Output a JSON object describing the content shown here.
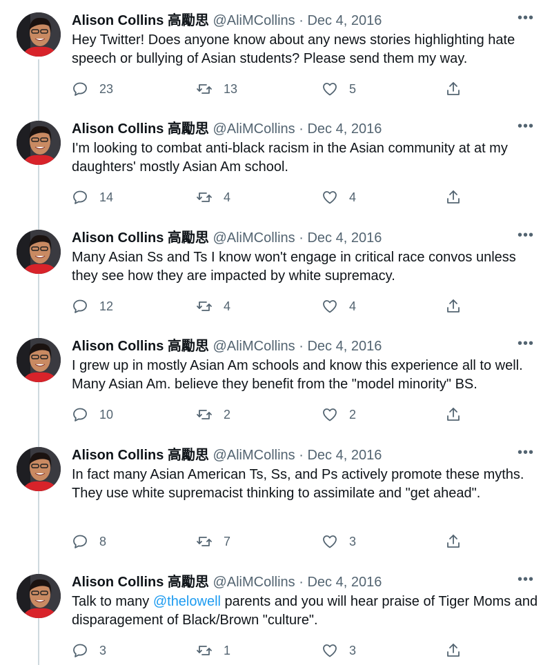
{
  "tweets": [
    {
      "name": "Alison Collins 高勵思",
      "handle": "@AliMCollins",
      "date": "Dec 4, 2016",
      "text": "Hey Twitter! Does anyone know about any news stories highlighting hate speech or bullying of Asian students? Please send them my way.",
      "replies": "23",
      "retweets": "13",
      "likes": "5"
    },
    {
      "name": "Alison Collins 高勵思",
      "handle": "@AliMCollins",
      "date": "Dec 4, 2016",
      "text": "I'm looking to combat anti-black racism in the Asian community at at my daughters' mostly Asian Am school.",
      "replies": "14",
      "retweets": "4",
      "likes": "4"
    },
    {
      "name": "Alison Collins 高勵思",
      "handle": "@AliMCollins",
      "date": "Dec 4, 2016",
      "text": "Many Asian Ss and Ts I know won't engage in critical race convos unless they see how they are impacted by white supremacy.",
      "replies": "12",
      "retweets": "4",
      "likes": "4"
    },
    {
      "name": "Alison Collins 高勵思",
      "handle": "@AliMCollins",
      "date": "Dec 4, 2016",
      "text": "I grew up in mostly Asian Am schools and know this experience all to well. Many Asian Am. believe they benefit from the \"model minority\" BS.",
      "replies": "10",
      "retweets": "2",
      "likes": "2"
    },
    {
      "name": "Alison Collins 高勵思",
      "handle": "@AliMCollins",
      "date": "Dec 4, 2016",
      "text": "In fact many Asian American Ts, Ss, and Ps actively promote these myths. They use white supremacist thinking to assimilate and \"get ahead\".",
      "replies": "8",
      "retweets": "7",
      "likes": "3"
    },
    {
      "name": "Alison Collins 高勵思",
      "handle": "@AliMCollins",
      "date": "Dec 4, 2016",
      "text_before": "Talk to many ",
      "mention": "@thelowell",
      "text_after": " parents and you will hear praise of Tiger Moms and disparagement of Black/Brown \"culture\".",
      "replies": "3",
      "retweets": "1",
      "likes": "3"
    }
  ],
  "separator": " · ",
  "icons": [
    "reply-icon",
    "retweet-icon",
    "like-icon",
    "share-icon",
    "more-icon"
  ],
  "colors": {
    "text": "#0f1419",
    "muted": "#536471",
    "link": "#1d9bf0",
    "thread": "#cfd9de"
  }
}
